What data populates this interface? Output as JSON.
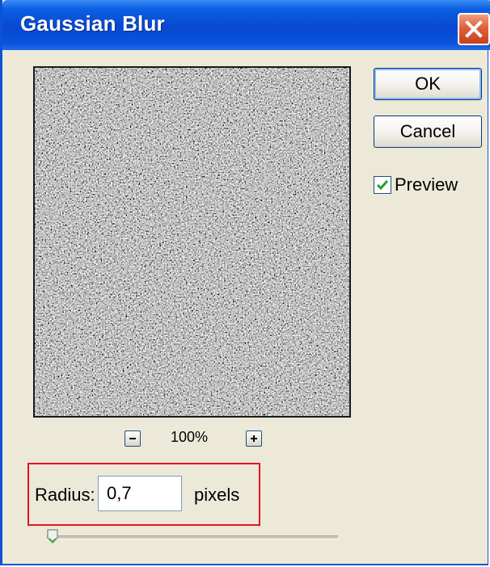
{
  "window": {
    "title": "Gaussian Blur"
  },
  "buttons": {
    "ok_label": "OK",
    "cancel_label": "Cancel"
  },
  "preview_toggle": {
    "label": "Preview",
    "checked": true
  },
  "zoom": {
    "level": "100%"
  },
  "radius": {
    "label": "Radius:",
    "value": "0,7",
    "unit": "pixels",
    "slider_fraction": 0.02
  },
  "icons": {
    "close": "close-icon",
    "zoom_out": "minus-icon",
    "zoom_in": "plus-icon",
    "check": "check-icon",
    "slider": "slider-thumb-icon"
  },
  "colors": {
    "title_bar": "#0848d0",
    "highlight": "#e8141a",
    "close_button": "#e0603a",
    "checkmark": "#21a121",
    "slider_thumb": "#3fa83f"
  }
}
